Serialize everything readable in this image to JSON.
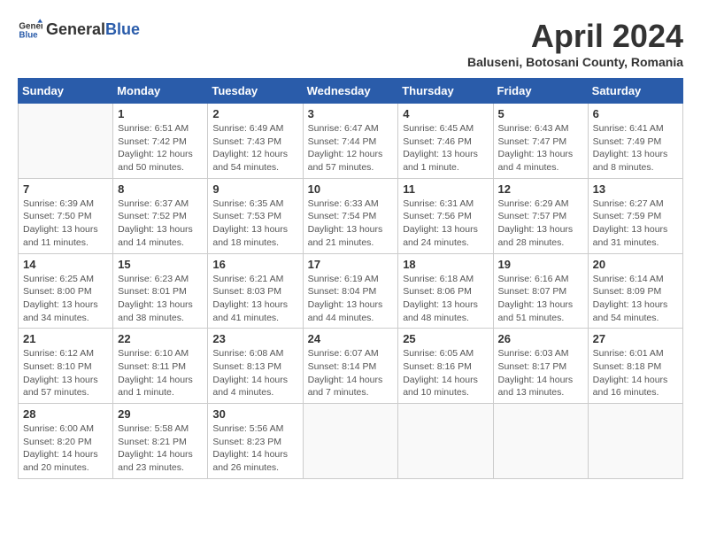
{
  "header": {
    "logo_general": "General",
    "logo_blue": "Blue",
    "month_title": "April 2024",
    "subtitle": "Baluseni, Botosani County, Romania"
  },
  "days_of_week": [
    "Sunday",
    "Monday",
    "Tuesday",
    "Wednesday",
    "Thursday",
    "Friday",
    "Saturday"
  ],
  "weeks": [
    [
      {
        "day": "",
        "info": ""
      },
      {
        "day": "1",
        "info": "Sunrise: 6:51 AM\nSunset: 7:42 PM\nDaylight: 12 hours\nand 50 minutes."
      },
      {
        "day": "2",
        "info": "Sunrise: 6:49 AM\nSunset: 7:43 PM\nDaylight: 12 hours\nand 54 minutes."
      },
      {
        "day": "3",
        "info": "Sunrise: 6:47 AM\nSunset: 7:44 PM\nDaylight: 12 hours\nand 57 minutes."
      },
      {
        "day": "4",
        "info": "Sunrise: 6:45 AM\nSunset: 7:46 PM\nDaylight: 13 hours\nand 1 minute."
      },
      {
        "day": "5",
        "info": "Sunrise: 6:43 AM\nSunset: 7:47 PM\nDaylight: 13 hours\nand 4 minutes."
      },
      {
        "day": "6",
        "info": "Sunrise: 6:41 AM\nSunset: 7:49 PM\nDaylight: 13 hours\nand 8 minutes."
      }
    ],
    [
      {
        "day": "7",
        "info": "Sunrise: 6:39 AM\nSunset: 7:50 PM\nDaylight: 13 hours\nand 11 minutes."
      },
      {
        "day": "8",
        "info": "Sunrise: 6:37 AM\nSunset: 7:52 PM\nDaylight: 13 hours\nand 14 minutes."
      },
      {
        "day": "9",
        "info": "Sunrise: 6:35 AM\nSunset: 7:53 PM\nDaylight: 13 hours\nand 18 minutes."
      },
      {
        "day": "10",
        "info": "Sunrise: 6:33 AM\nSunset: 7:54 PM\nDaylight: 13 hours\nand 21 minutes."
      },
      {
        "day": "11",
        "info": "Sunrise: 6:31 AM\nSunset: 7:56 PM\nDaylight: 13 hours\nand 24 minutes."
      },
      {
        "day": "12",
        "info": "Sunrise: 6:29 AM\nSunset: 7:57 PM\nDaylight: 13 hours\nand 28 minutes."
      },
      {
        "day": "13",
        "info": "Sunrise: 6:27 AM\nSunset: 7:59 PM\nDaylight: 13 hours\nand 31 minutes."
      }
    ],
    [
      {
        "day": "14",
        "info": "Sunrise: 6:25 AM\nSunset: 8:00 PM\nDaylight: 13 hours\nand 34 minutes."
      },
      {
        "day": "15",
        "info": "Sunrise: 6:23 AM\nSunset: 8:01 PM\nDaylight: 13 hours\nand 38 minutes."
      },
      {
        "day": "16",
        "info": "Sunrise: 6:21 AM\nSunset: 8:03 PM\nDaylight: 13 hours\nand 41 minutes."
      },
      {
        "day": "17",
        "info": "Sunrise: 6:19 AM\nSunset: 8:04 PM\nDaylight: 13 hours\nand 44 minutes."
      },
      {
        "day": "18",
        "info": "Sunrise: 6:18 AM\nSunset: 8:06 PM\nDaylight: 13 hours\nand 48 minutes."
      },
      {
        "day": "19",
        "info": "Sunrise: 6:16 AM\nSunset: 8:07 PM\nDaylight: 13 hours\nand 51 minutes."
      },
      {
        "day": "20",
        "info": "Sunrise: 6:14 AM\nSunset: 8:09 PM\nDaylight: 13 hours\nand 54 minutes."
      }
    ],
    [
      {
        "day": "21",
        "info": "Sunrise: 6:12 AM\nSunset: 8:10 PM\nDaylight: 13 hours\nand 57 minutes."
      },
      {
        "day": "22",
        "info": "Sunrise: 6:10 AM\nSunset: 8:11 PM\nDaylight: 14 hours\nand 1 minute."
      },
      {
        "day": "23",
        "info": "Sunrise: 6:08 AM\nSunset: 8:13 PM\nDaylight: 14 hours\nand 4 minutes."
      },
      {
        "day": "24",
        "info": "Sunrise: 6:07 AM\nSunset: 8:14 PM\nDaylight: 14 hours\nand 7 minutes."
      },
      {
        "day": "25",
        "info": "Sunrise: 6:05 AM\nSunset: 8:16 PM\nDaylight: 14 hours\nand 10 minutes."
      },
      {
        "day": "26",
        "info": "Sunrise: 6:03 AM\nSunset: 8:17 PM\nDaylight: 14 hours\nand 13 minutes."
      },
      {
        "day": "27",
        "info": "Sunrise: 6:01 AM\nSunset: 8:18 PM\nDaylight: 14 hours\nand 16 minutes."
      }
    ],
    [
      {
        "day": "28",
        "info": "Sunrise: 6:00 AM\nSunset: 8:20 PM\nDaylight: 14 hours\nand 20 minutes."
      },
      {
        "day": "29",
        "info": "Sunrise: 5:58 AM\nSunset: 8:21 PM\nDaylight: 14 hours\nand 23 minutes."
      },
      {
        "day": "30",
        "info": "Sunrise: 5:56 AM\nSunset: 8:23 PM\nDaylight: 14 hours\nand 26 minutes."
      },
      {
        "day": "",
        "info": ""
      },
      {
        "day": "",
        "info": ""
      },
      {
        "day": "",
        "info": ""
      },
      {
        "day": "",
        "info": ""
      }
    ]
  ]
}
